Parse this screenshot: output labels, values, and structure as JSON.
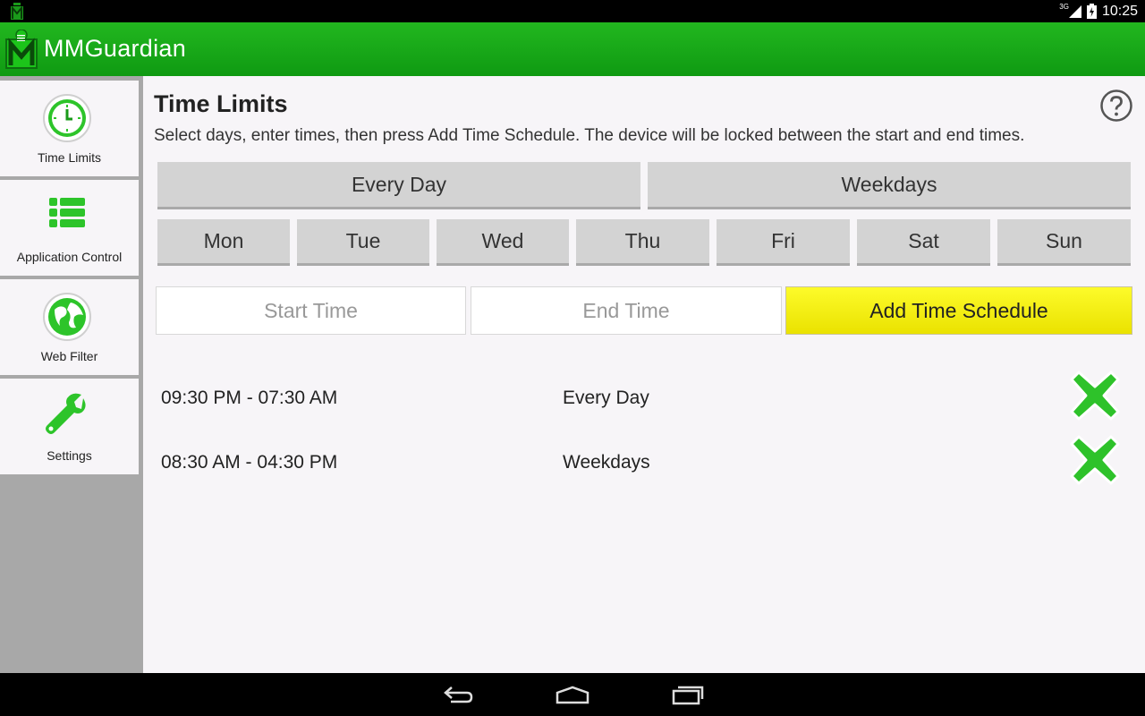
{
  "status_bar": {
    "network_label": "3G",
    "clock": "10:25"
  },
  "app": {
    "title": "MMGuardian"
  },
  "sidebar": {
    "items": [
      {
        "label": "Time Limits",
        "icon": "clock-icon"
      },
      {
        "label": "Application Control",
        "icon": "list-icon"
      },
      {
        "label": "Web Filter",
        "icon": "globe-icon"
      },
      {
        "label": "Settings",
        "icon": "wrench-icon"
      }
    ]
  },
  "main": {
    "title": "Time Limits",
    "instructions": "Select days, enter times, then press Add Time Schedule. The device will be locked between the start and end times.",
    "presets": [
      "Every Day",
      "Weekdays"
    ],
    "days": [
      "Mon",
      "Tue",
      "Wed",
      "Thu",
      "Fri",
      "Sat",
      "Sun"
    ],
    "start_time_placeholder": "Start Time",
    "end_time_placeholder": "End Time",
    "add_button_label": "Add Time Schedule",
    "schedules": [
      {
        "time": "09:30 PM - 07:30 AM",
        "days": "Every Day"
      },
      {
        "time": "08:30 AM - 04:30 PM",
        "days": "Weekdays"
      }
    ]
  },
  "colors": {
    "brand_green": "#1cab1a",
    "accent_yellow": "#f5f000",
    "delete_green": "#2ec22a"
  }
}
